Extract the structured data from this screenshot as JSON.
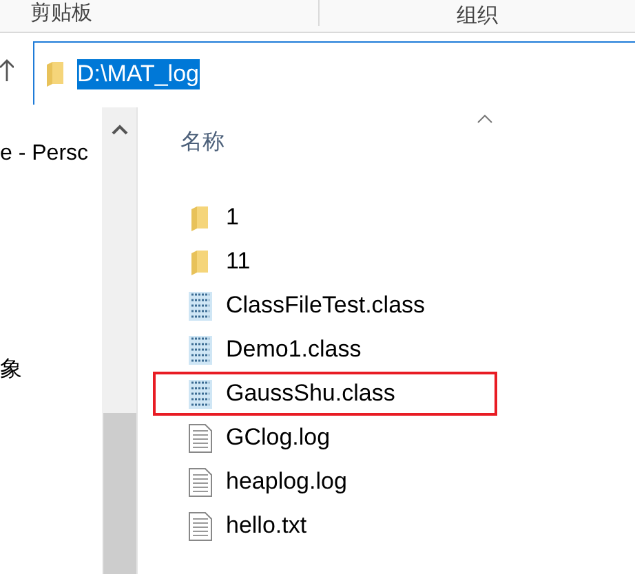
{
  "ribbon": {
    "groups": [
      "剪贴板",
      "组织"
    ]
  },
  "address_bar": {
    "value": "D:\\MAT_log",
    "text_selected": true
  },
  "nav_pane": {
    "items": [
      "e - Persc",
      "象"
    ]
  },
  "file_list": {
    "column_header": "名称",
    "files": [
      {
        "name": "1",
        "kind": "folder",
        "highlighted": false
      },
      {
        "name": "11",
        "kind": "folder",
        "highlighted": false
      },
      {
        "name": "ClassFileTest.class",
        "kind": "class",
        "highlighted": false
      },
      {
        "name": "Demo1.class",
        "kind": "class",
        "highlighted": false
      },
      {
        "name": "GaussShu.class",
        "kind": "class",
        "highlighted": true
      },
      {
        "name": "GClog.log",
        "kind": "text",
        "highlighted": false
      },
      {
        "name": "heaplog.log",
        "kind": "text",
        "highlighted": false
      },
      {
        "name": "hello.txt",
        "kind": "text",
        "highlighted": false
      }
    ]
  }
}
